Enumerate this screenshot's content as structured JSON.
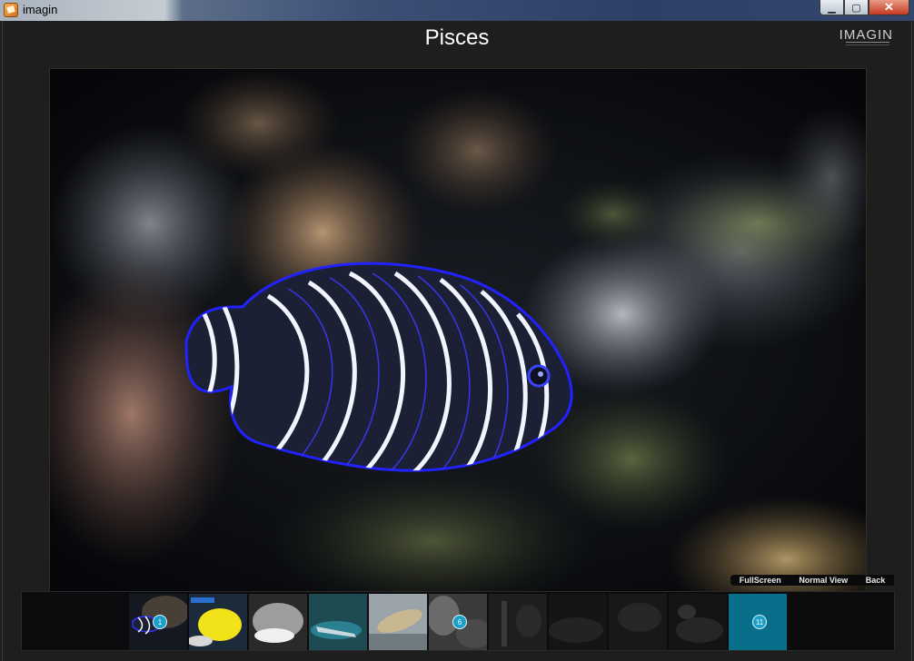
{
  "window": {
    "title": "imagin",
    "minimize": "▁",
    "maximize": "▢",
    "close": "✕"
  },
  "app": {
    "brand": "IMAGIN"
  },
  "photo": {
    "title": "Pisces"
  },
  "view_controls": [
    {
      "label": "FullScreen"
    },
    {
      "label": "Normal View"
    },
    {
      "label": "Back"
    }
  ],
  "thumbnails": [
    {
      "badge": "1"
    },
    {
      "badge": ""
    },
    {
      "badge": ""
    },
    {
      "badge": ""
    },
    {
      "badge": ""
    },
    {
      "badge": "6"
    },
    {
      "badge": ""
    },
    {
      "badge": ""
    },
    {
      "badge": ""
    },
    {
      "badge": ""
    },
    {
      "badge": "11"
    }
  ],
  "colors": {
    "accent": "#1a9fc9",
    "selected": "#086f8a",
    "background": "#1e1e1e"
  }
}
